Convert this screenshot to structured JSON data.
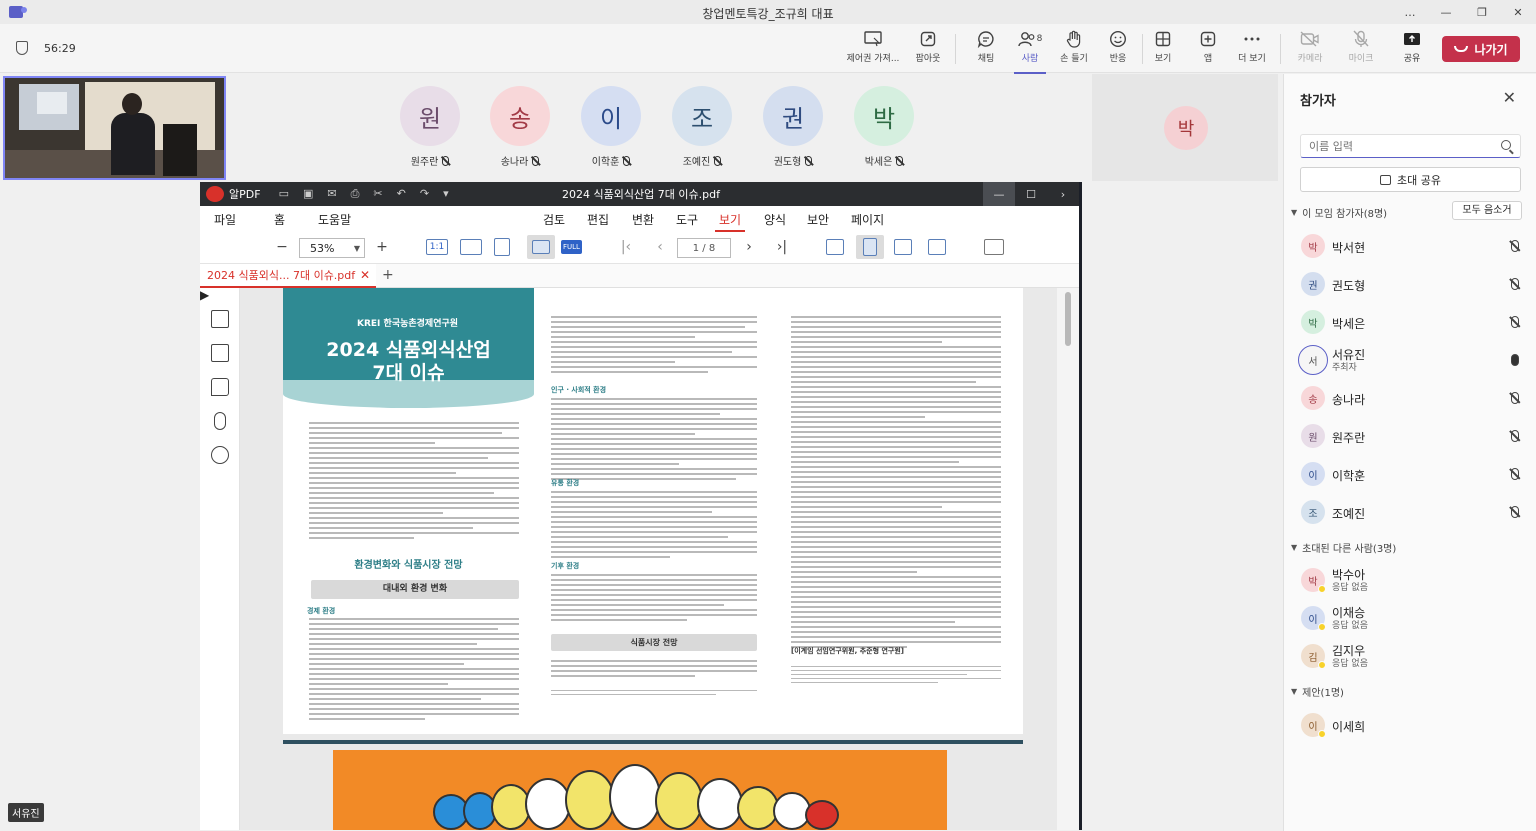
{
  "window": {
    "title": "창업멘토특강_조규희 대표",
    "controls": [
      "…",
      "—",
      "❐",
      "✕"
    ]
  },
  "meeting": {
    "timer": "56:29",
    "toolbar": [
      {
        "id": "content",
        "label": "제어권 가져...",
        "icon": "monitor-pointer-icon",
        "disabled": false
      },
      {
        "id": "popout",
        "label": "팝아웃",
        "icon": "popout-icon",
        "disabled": false
      },
      {
        "id": "chat",
        "label": "채팅",
        "icon": "chat-icon",
        "disabled": false
      },
      {
        "id": "people",
        "label": "사람",
        "icon": "people-icon",
        "count": "8",
        "active": true
      },
      {
        "id": "raise",
        "label": "손 들기",
        "icon": "hand-icon",
        "disabled": false
      },
      {
        "id": "react",
        "label": "반응",
        "icon": "smile-icon",
        "disabled": false
      },
      {
        "id": "view",
        "label": "보기",
        "icon": "grid-icon",
        "disabled": false
      },
      {
        "id": "apps",
        "label": "앱",
        "icon": "plus-square-icon",
        "disabled": false
      },
      {
        "id": "more",
        "label": "더 보기",
        "icon": "more-icon",
        "disabled": false
      },
      {
        "id": "camera",
        "label": "카메라",
        "icon": "camera-off-icon",
        "disabled": true
      },
      {
        "id": "mic",
        "label": "마이크",
        "icon": "mic-off-icon",
        "disabled": true
      },
      {
        "id": "share",
        "label": "공유",
        "icon": "share-up-icon",
        "disabled": false
      }
    ],
    "leave_label": "나가기",
    "self_name_tag": "서유진"
  },
  "stage": {
    "tiles": [
      {
        "initial": "원",
        "name": "원주란",
        "bg": "#e8dde8",
        "fg": "#6b4c6b"
      },
      {
        "initial": "송",
        "name": "송나라",
        "bg": "#f8d7d9",
        "fg": "#a23a46"
      },
      {
        "initial": "이",
        "name": "이학훈",
        "bg": "#d5def2",
        "fg": "#2b4a8a"
      },
      {
        "initial": "조",
        "name": "조예진",
        "bg": "#d6e2ee",
        "fg": "#2d4f6f"
      },
      {
        "initial": "권",
        "name": "권도형",
        "bg": "#d4deef",
        "fg": "#2e4b80"
      },
      {
        "initial": "박",
        "name": "박세은",
        "bg": "#d5efdf",
        "fg": "#2e6b44"
      }
    ],
    "right_tile_initial": "박"
  },
  "pdf": {
    "app_name": "알PDF",
    "doc_title": "2024 식품외식산업 7대 이슈.pdf",
    "menu": [
      "파일",
      "홈",
      "도움말",
      "검토",
      "편집",
      "변환",
      "도구",
      "보기",
      "양식",
      "보안",
      "페이지"
    ],
    "active_menu": "보기",
    "zoom": "53%",
    "page_indicator": "1 / 8",
    "tab_label": "2024 식품외식... 7대 이슈.pdf",
    "tool_labels": {
      "one_to_one": "1:1",
      "full": "FULL"
    },
    "cover": {
      "org": "KREI 한국농촌경제연구원",
      "title_line1": "2024 식품외식산업",
      "title_line2": "7대 이슈",
      "section": "환경변화와 식품시장 전망",
      "box": "대내외 환경 변화",
      "sub": "경제 환경"
    },
    "col2": {
      "heading1": "인구 · 사회적 환경",
      "heading2": "유통 환경",
      "heading3": "기후 환경",
      "box": "식품시장 전망"
    },
    "col3": {
      "footer_org": "[이계임 선임연구위원, 추준형 연구원]"
    }
  },
  "panel": {
    "title": "참가자",
    "search_placeholder": "이름 입력",
    "share_label": "초대 공유",
    "in_meeting_label": "이 모임 참가자(8명)",
    "mute_all_label": "모두 음소거",
    "in_meeting": [
      {
        "initial": "박",
        "name": "박서현",
        "bg": "#f8d7d9",
        "fg": "#a23a46",
        "mic": "off"
      },
      {
        "initial": "권",
        "name": "권도형",
        "bg": "#d4deef",
        "fg": "#2e4b80",
        "mic": "off"
      },
      {
        "initial": "박",
        "name": "박세은",
        "bg": "#d5efdf",
        "fg": "#2e6b44",
        "mic": "off"
      },
      {
        "initial": "서",
        "name": "서유진",
        "role": "주최자",
        "bg": "#f6f6f6",
        "fg": "#555555",
        "mic": "on",
        "ring": true
      },
      {
        "initial": "송",
        "name": "송나라",
        "bg": "#f8d7d9",
        "fg": "#a23a46",
        "mic": "off"
      },
      {
        "initial": "원",
        "name": "원주란",
        "bg": "#e8dde8",
        "fg": "#6b4c6b",
        "mic": "off"
      },
      {
        "initial": "이",
        "name": "이학훈",
        "bg": "#d5def2",
        "fg": "#2b4a8a",
        "mic": "off"
      },
      {
        "initial": "조",
        "name": "조예진",
        "bg": "#d6e2ee",
        "fg": "#2d4f6f",
        "mic": "off"
      }
    ],
    "invited_label": "초대된 다른 사람(3명)",
    "invited": [
      {
        "initial": "박",
        "name": "박수아",
        "role": "응답 없음",
        "bg": "#f8d7d9",
        "fg": "#a23a46"
      },
      {
        "initial": "이",
        "name": "이채승",
        "role": "응답 없음",
        "bg": "#d5def2",
        "fg": "#2b4a8a"
      },
      {
        "initial": "김",
        "name": "김지우",
        "role": "응답 없음",
        "bg": "#f0dfce",
        "fg": "#8a5a2b"
      }
    ],
    "suggested_label": "제안(1명)",
    "suggested": [
      {
        "initial": "이",
        "name": "이세희",
        "bg": "#f0dfce",
        "fg": "#8a5a2b"
      }
    ]
  },
  "colors": {
    "accent": "#5b5fc7",
    "leave": "#c4314b",
    "pdf_red": "#d8312a",
    "cover_teal": "#2f8a93"
  }
}
